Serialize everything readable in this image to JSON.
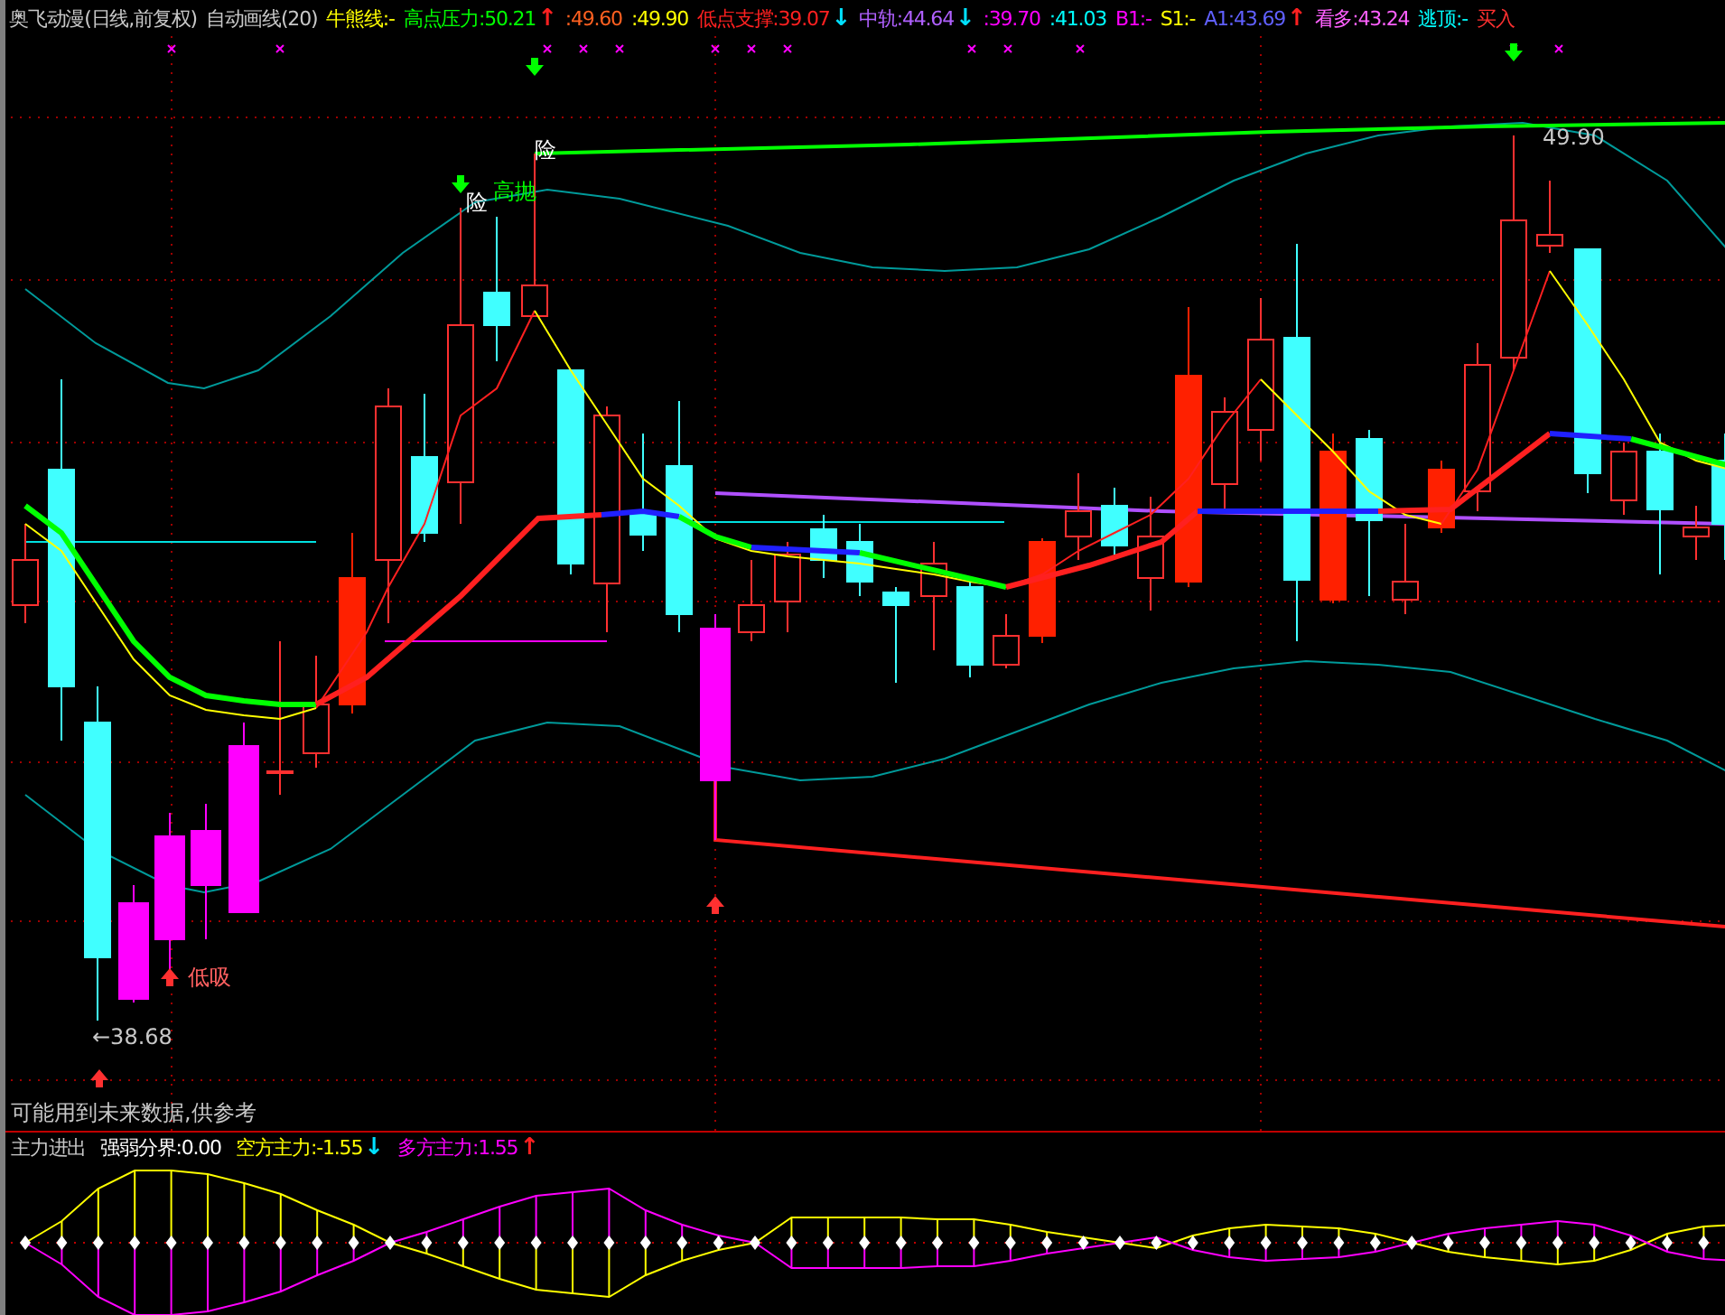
{
  "header": {
    "items": [
      {
        "text": "奥飞动漫(日线,前复权)",
        "color": "#c8c8c8"
      },
      {
        "text": "自动画线(20)",
        "color": "#c8c8c8"
      },
      {
        "text": "牛熊线:-",
        "color": "#ffff00"
      },
      {
        "text": "高点压力:50.21",
        "color": "#00ff00",
        "arrow": {
          "text": "↑",
          "color": "#ff2020"
        }
      },
      {
        "text": ":49.60",
        "color": "#ff6020"
      },
      {
        "text": ":49.90",
        "color": "#ffff00"
      },
      {
        "text": "低点支撑:39.07",
        "color": "#ff2020",
        "arrow": {
          "text": "↓",
          "color": "#00e0ff"
        }
      },
      {
        "text": "中轨:44.64",
        "color": "#b060ff",
        "arrow": {
          "text": "↓",
          "color": "#00e0ff"
        }
      },
      {
        "text": ":39.70",
        "color": "#ff00ff"
      },
      {
        "text": ":41.03",
        "color": "#00ffff"
      },
      {
        "text": "B1:-",
        "color": "#ff00ff"
      },
      {
        "text": "S1:-",
        "color": "#ffff00"
      },
      {
        "text": "A1:43.69",
        "color": "#6060ff",
        "arrow": {
          "text": "↑",
          "color": "#ff2020"
        }
      },
      {
        "text": "看多:43.24",
        "color": "#ff60ff"
      },
      {
        "text": "逃顶:-",
        "color": "#00ffff"
      },
      {
        "text": "买入",
        "color": "#ff3030"
      }
    ]
  },
  "chart": {
    "labels": [
      {
        "text": "险",
        "kind": "risk"
      },
      {
        "text": "高抛",
        "kind": "signal"
      },
      {
        "text": "险",
        "kind": "risk"
      },
      {
        "text": "49.90",
        "kind": "price"
      },
      {
        "text": "←38.68",
        "kind": "price"
      },
      {
        "text": "低吸",
        "kind": "buy"
      }
    ],
    "footnote": "可能用到未来数据,供参考"
  },
  "indicator": {
    "items": [
      {
        "text": "主力进出",
        "color": "#c8c8c8"
      },
      {
        "text": "强弱分界:0.00",
        "color": "#ffffff"
      },
      {
        "text": "空方主力:-1.55",
        "color": "#ffff00",
        "arrow": {
          "text": "↓",
          "color": "#00e0ff"
        }
      },
      {
        "text": "多方主力:1.55",
        "color": "#ff00ff",
        "arrow": {
          "text": "↑",
          "color": "#ff2020"
        }
      }
    ]
  }
}
